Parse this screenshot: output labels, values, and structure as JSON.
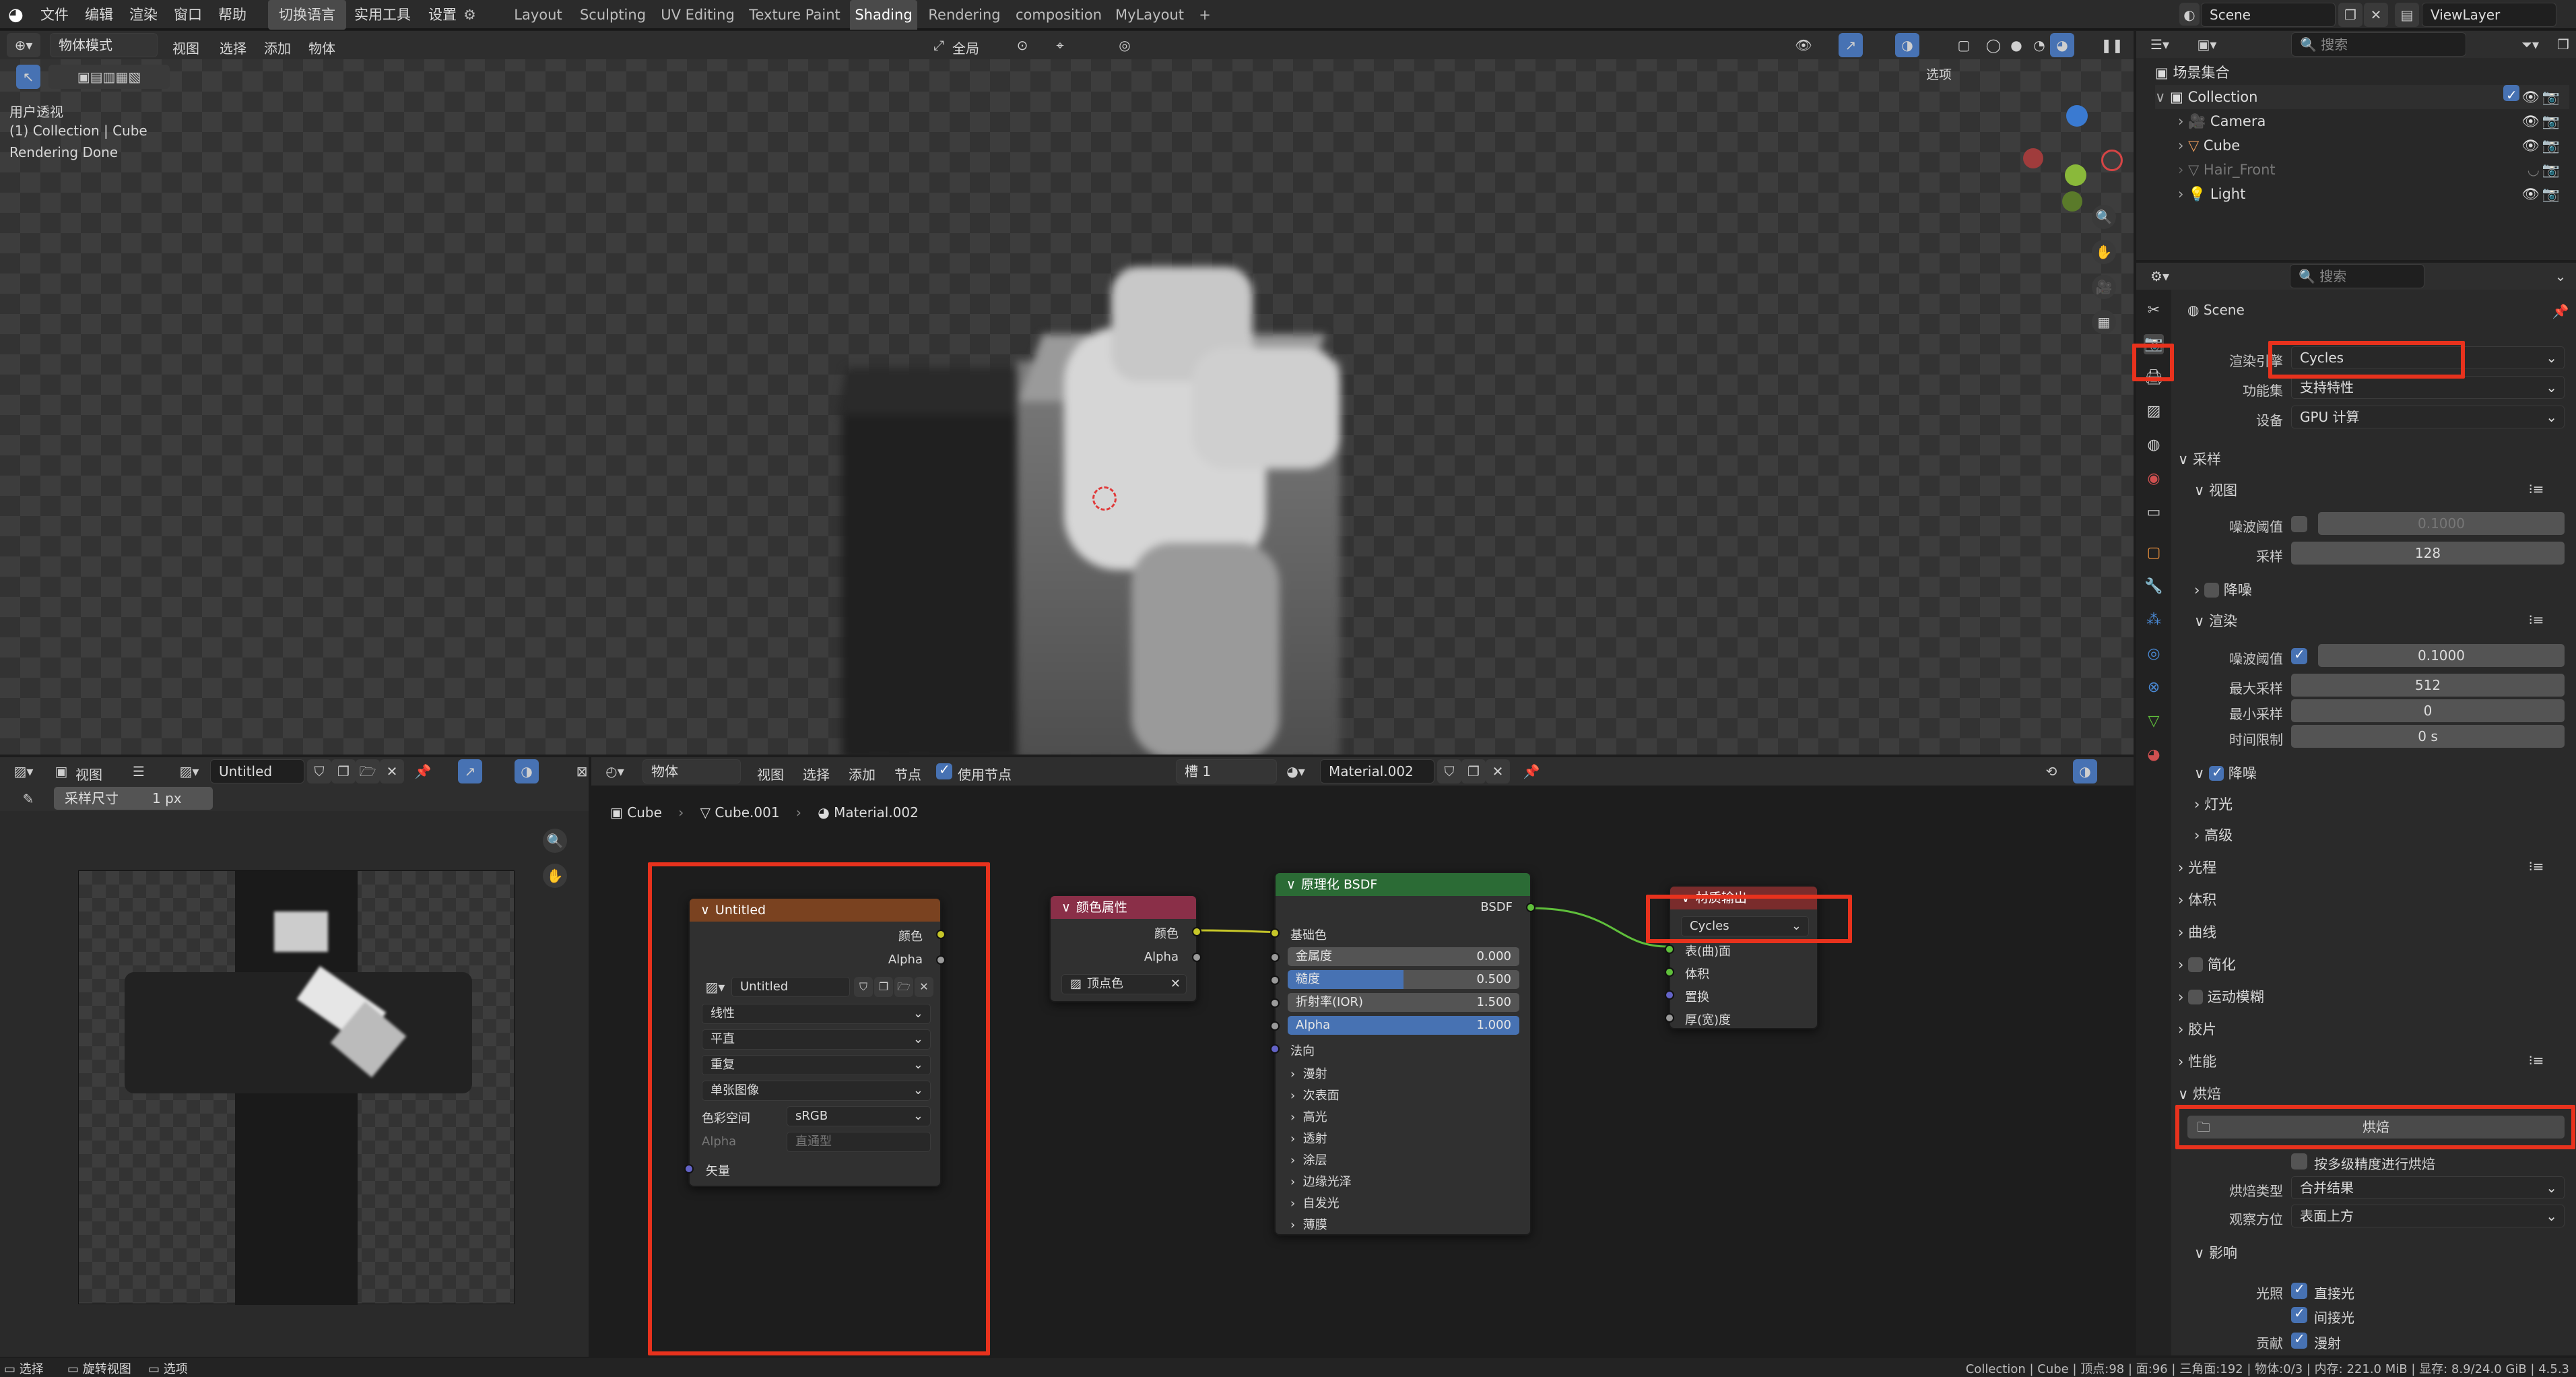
{
  "app": {
    "logo_icon": "blender-logo-icon"
  },
  "menu": [
    "文件",
    "编辑",
    "渲染",
    "窗口",
    "帮助",
    "切换语言",
    "实用工具",
    "设置"
  ],
  "workspaces": [
    "Layout",
    "Sculpting",
    "UV Editing",
    "Texture Paint",
    "Shading",
    "Rendering",
    "composition",
    "MyLayout",
    "+"
  ],
  "active_workspace": "Shading",
  "scene_name": "Scene",
  "view_layer": "ViewLayer",
  "viewport": {
    "mode": "物体模式",
    "menus": [
      "视图",
      "选择",
      "添加",
      "物体"
    ],
    "transform": "全局",
    "options": "选项",
    "info": [
      "用户透视",
      "(1) Collection | Cube",
      "Rendering Done"
    ]
  },
  "image_editor": {
    "menu_view": "视图",
    "image_name": "Untitled",
    "tool_label": "采样尺寸",
    "tool_value": "1 px"
  },
  "node_editor": {
    "mode": "物体",
    "menus": [
      "视图",
      "选择",
      "添加",
      "节点"
    ],
    "use_nodes": "使用节点",
    "slot": "槽 1",
    "material": "Material.002",
    "breadcrumbs": [
      "Cube",
      "Cube.001",
      "Material.002"
    ]
  },
  "nodes": {
    "image_texture": {
      "title": "Untitled",
      "out_color": "颜色",
      "out_alpha": "Alpha",
      "image": "Untitled",
      "interpolation": "线性",
      "projection": "平直",
      "extension": "重复",
      "source": "单张图像",
      "colorspace_label": "色彩空间",
      "colorspace_value": "sRGB",
      "alpha_label": "Alpha",
      "alpha_value": "直通型",
      "in_vector": "矢量"
    },
    "color_attr": {
      "title": "颜色属性",
      "out_color": "颜色",
      "out_alpha": "Alpha",
      "layer": "顶点色"
    },
    "bsdf": {
      "title": "原理化 BSDF",
      "out": "BSDF",
      "base_color": "基础色",
      "fields": [
        {
          "label": "金属度",
          "value": "0.000"
        },
        {
          "label": "糙度",
          "value": "0.500"
        },
        {
          "label": "折射率(IOR)",
          "value": "1.500"
        },
        {
          "label": "Alpha",
          "value": "1.000"
        }
      ],
      "normal": "法向",
      "panels": [
        "漫射",
        "次表面",
        "高光",
        "透射",
        "涂层",
        "边缘光泽",
        "自发光",
        "薄膜"
      ]
    },
    "output": {
      "title": "材质输出",
      "target": "Cycles",
      "inputs": [
        "表(曲)面",
        "体积",
        "置换",
        "厚(宽)度"
      ]
    }
  },
  "outliner": {
    "search_placeholder": "搜索",
    "root": "场景集合",
    "collection": "Collection",
    "items": [
      "Camera",
      "Cube",
      "Hair_Front",
      "Light"
    ]
  },
  "properties": {
    "search_placeholder": "搜索",
    "context": "Scene",
    "render_engine_label": "渲染引擎",
    "render_engine": "Cycles",
    "feature_set_label": "功能集",
    "feature_set": "支持特性",
    "device_label": "设备",
    "device": "GPU 计算",
    "sampling": "采样",
    "viewport": "视图",
    "noise_threshold": "噪波阈值",
    "vp_threshold": "0.1000",
    "samples_label": "采样",
    "vp_samples": "128",
    "denoise": "降噪",
    "render": "渲染",
    "r_threshold": "0.1000",
    "max_samples_label": "最大采样",
    "max_samples": "512",
    "min_samples_label": "最小采样",
    "min_samples": "0",
    "time_limit_label": "时间限制",
    "time_limit": "0 s",
    "r_denoise": "降噪",
    "lights": "灯光",
    "advanced": "高级",
    "sections": [
      "光程",
      "体积",
      "曲线",
      "简化",
      "运动模糊",
      "胶片",
      "性能",
      "烘焙"
    ],
    "bake_button": "烘焙",
    "multires": "按多级精度进行烘焙",
    "bake_type_label": "烘焙类型",
    "bake_type": "合并结果",
    "view_from_label": "观察方位",
    "view_from": "表面上方",
    "influence": "影响",
    "lighting_label": "光照",
    "direct": "直接光",
    "indirect": "间接光",
    "contrib_label": "贡献",
    "diffuse": "漫射"
  },
  "statusbar": {
    "left": [
      "选择",
      "旋转视图",
      "选项"
    ],
    "right": "Collection | Cube | 顶点:98 | 面:96 | 三角面:192 | 物体:0/3 | 内存: 221.0 MiB | 显存: 8.9/24.0 GiB | 4.5.3"
  }
}
